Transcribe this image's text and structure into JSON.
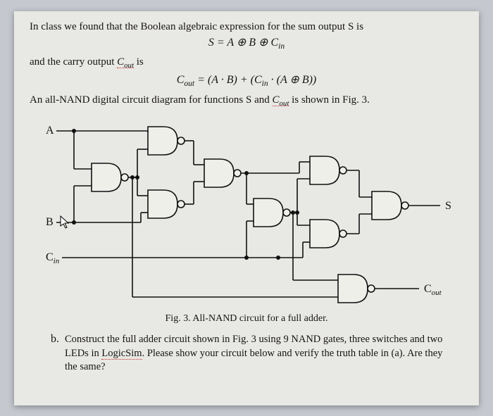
{
  "text": {
    "intro": "In class we found that the Boolean algebraic expression for the sum output S is",
    "eq1_lhs": "S",
    "eq1_rhs": "A ⊕ B ⊕ C",
    "eq1_sub": "in",
    "carry_intro_pre": "and the carry output ",
    "carry_intro_word": "C",
    "carry_intro_sub": "out",
    "carry_intro_post": " is",
    "eq2_lhs_c": "C",
    "eq2_lhs_sub": "out",
    "eq2_rhs_a": "(A · B) + (C",
    "eq2_rhs_sub": "in",
    "eq2_rhs_b": " · (A ⊕ B))",
    "circuit_intro_a": "An all-NAND digital circuit diagram for functions S and ",
    "circuit_intro_word": "C",
    "circuit_intro_sub": "out",
    "circuit_intro_b": " is shown in Fig. 3.",
    "caption": "Fig. 3. All-NAND circuit for a full adder.",
    "q_label": "b.",
    "q_text_a": "Construct the full adder circuit shown in Fig. 3 using 9 NAND gates, three switches and two LEDs in ",
    "q_text_word": "LogicSim",
    "q_text_b": ". Please show your circuit below and verify the truth table in (a). Are they the same?"
  },
  "diagram": {
    "inputs": {
      "A": "A",
      "B": "B",
      "C": "C"
    },
    "outputs": {
      "S": "S",
      "Cout_c": "C",
      "Cout_sub": "out"
    },
    "C_sub": "in"
  }
}
